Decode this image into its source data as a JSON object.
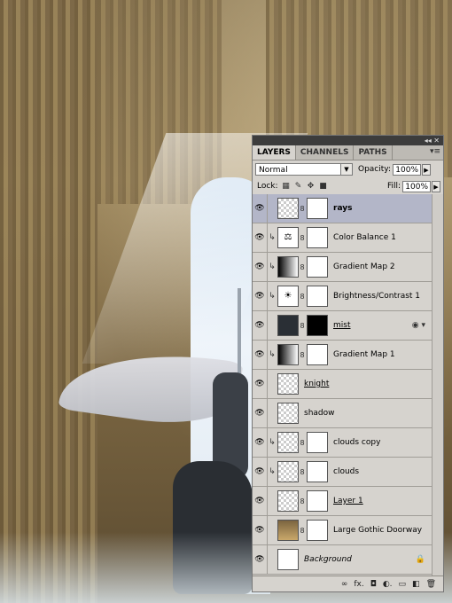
{
  "panel": {
    "tabs": [
      "LAYERS",
      "CHANNELS",
      "PATHS"
    ],
    "blend_mode": "Normal",
    "opacity_label": "Opacity:",
    "opacity_value": "100%",
    "lock_label": "Lock:",
    "fill_label": "Fill:",
    "fill_value": "100%"
  },
  "layers": [
    {
      "name": "rays",
      "selected": true
    },
    {
      "name": "Color Balance 1"
    },
    {
      "name": "Gradient Map 2"
    },
    {
      "name": "Brightness/Contrast 1"
    },
    {
      "name": "mist"
    },
    {
      "name": "Gradient Map 1"
    },
    {
      "name": "knight"
    },
    {
      "name": "shadow"
    },
    {
      "name": "clouds copy"
    },
    {
      "name": "clouds"
    },
    {
      "name": "Layer 1"
    },
    {
      "name": "Large Gothic Doorway"
    },
    {
      "name": "Background"
    }
  ]
}
